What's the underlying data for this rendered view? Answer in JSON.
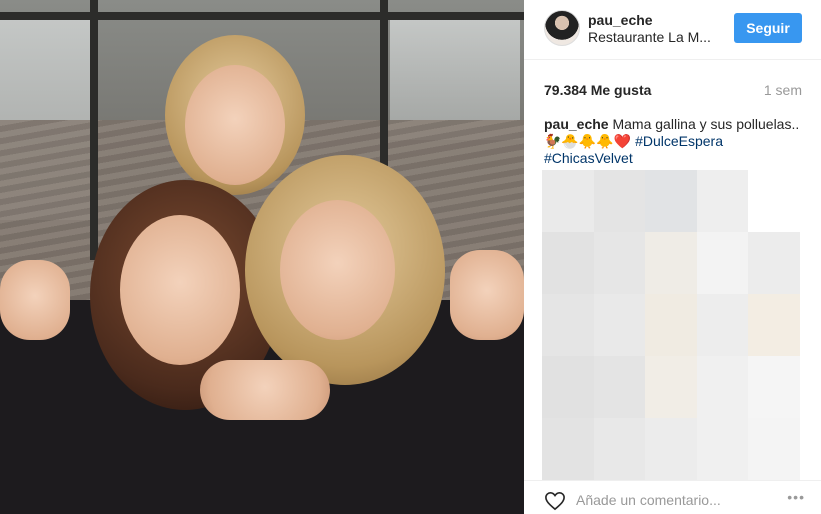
{
  "header": {
    "username": "pau_eche",
    "location": "Restaurante La M...",
    "follow_label": "Seguir"
  },
  "post": {
    "likes": "79.384 Me gusta",
    "time": "1 sem",
    "caption_user": "pau_eche",
    "caption_text": "Mama gallina y sus polluelas.. 🐓🐣🐥🐥❤️",
    "tag1": "#DulceEspera",
    "tag2": "#ChicasVelvet"
  },
  "comment": {
    "placeholder": "Añade un comentario...",
    "more": "•••"
  },
  "colors": {
    "accent": "#3897f0",
    "hashtag": "#003569"
  }
}
